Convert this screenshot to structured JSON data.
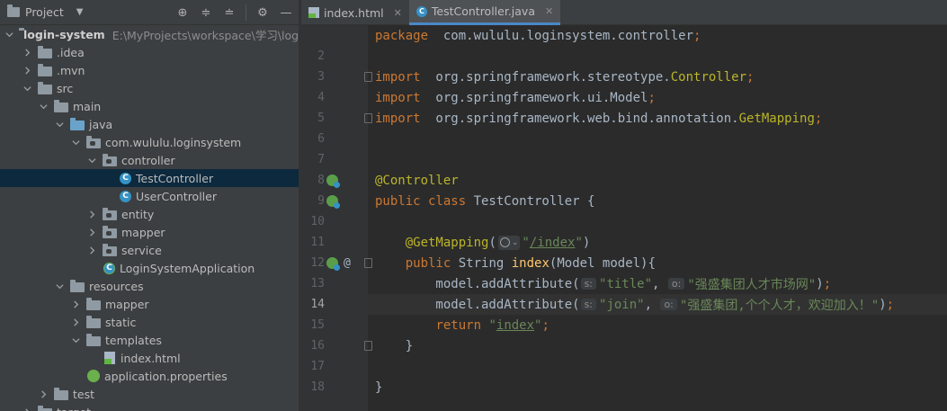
{
  "project_panel": {
    "title": "Project",
    "toolbar_icons": [
      "locate-icon",
      "expand-all-icon",
      "collapse-all-icon",
      "gear-icon",
      "minimize-icon"
    ],
    "tree": [
      {
        "label": "login-system",
        "path": "E:\\MyProjects\\workspace\\学习\\login-system",
        "depth": 0,
        "expanded": true,
        "icon": "folder-module-icon",
        "bold": true
      },
      {
        "label": ".idea",
        "depth": 1,
        "expanded": false,
        "icon": "folder-icon"
      },
      {
        "label": ".mvn",
        "depth": 1,
        "expanded": false,
        "icon": "folder-icon"
      },
      {
        "label": "src",
        "depth": 1,
        "expanded": true,
        "icon": "folder-icon"
      },
      {
        "label": "main",
        "depth": 2,
        "expanded": true,
        "icon": "folder-icon"
      },
      {
        "label": "java",
        "depth": 3,
        "expanded": true,
        "icon": "source-folder-icon"
      },
      {
        "label": "com.wululu.loginsystem",
        "depth": 4,
        "expanded": true,
        "icon": "package-icon"
      },
      {
        "label": "controller",
        "depth": 5,
        "expanded": true,
        "icon": "package-icon"
      },
      {
        "label": "TestController",
        "depth": 6,
        "icon": "java-class-icon",
        "selected": true
      },
      {
        "label": "UserController",
        "depth": 6,
        "icon": "java-class-icon"
      },
      {
        "label": "entity",
        "depth": 5,
        "expanded": false,
        "icon": "package-icon"
      },
      {
        "label": "mapper",
        "depth": 5,
        "expanded": false,
        "icon": "package-icon"
      },
      {
        "label": "service",
        "depth": 5,
        "expanded": false,
        "icon": "package-icon"
      },
      {
        "label": "LoginSystemApplication",
        "depth": 5,
        "icon": "spring-app-class-icon"
      },
      {
        "label": "resources",
        "depth": 3,
        "expanded": true,
        "icon": "resources-folder-icon"
      },
      {
        "label": "mapper",
        "depth": 4,
        "expanded": false,
        "icon": "folder-icon"
      },
      {
        "label": "static",
        "depth": 4,
        "expanded": false,
        "icon": "folder-icon"
      },
      {
        "label": "templates",
        "depth": 4,
        "expanded": true,
        "icon": "folder-icon"
      },
      {
        "label": "index.html",
        "depth": 5,
        "icon": "html-file-icon"
      },
      {
        "label": "application.properties",
        "depth": 4,
        "icon": "properties-file-icon"
      },
      {
        "label": "test",
        "depth": 2,
        "expanded": false,
        "icon": "folder-icon"
      },
      {
        "label": "target",
        "depth": 1,
        "expanded": false,
        "icon": "folder-icon"
      }
    ]
  },
  "editor": {
    "tabs": [
      {
        "label": "index.html",
        "icon": "html-file-icon",
        "active": false
      },
      {
        "label": "TestController.java",
        "icon": "java-class-icon",
        "active": true
      }
    ],
    "current_line": 14,
    "lines": [
      {
        "n": "",
        "tokens": [
          [
            "kw",
            "package"
          ],
          [
            "",
            "  com.wululu.loginsystem.controller"
          ],
          [
            "kw",
            ";"
          ]
        ]
      },
      {
        "n": "2",
        "tokens": []
      },
      {
        "n": "3",
        "tokens": [
          [
            "kw",
            "import"
          ],
          [
            "",
            "  org.springframework.stereotype."
          ],
          [
            "ann",
            "Controller"
          ],
          [
            "kw",
            ";"
          ]
        ],
        "fold": true
      },
      {
        "n": "4",
        "tokens": [
          [
            "kw",
            "import"
          ],
          [
            "",
            "  org.springframework.ui.Model"
          ],
          [
            "kw",
            ";"
          ]
        ]
      },
      {
        "n": "5",
        "tokens": [
          [
            "kw",
            "import"
          ],
          [
            "",
            "  org.springframework.web.bind.annotation."
          ],
          [
            "ann",
            "GetMapping"
          ],
          [
            "kw",
            ";"
          ]
        ],
        "fold": true
      },
      {
        "n": "6",
        "tokens": []
      },
      {
        "n": "7",
        "tokens": []
      },
      {
        "n": "8",
        "tokens": [
          [
            "ann",
            "@Controller"
          ]
        ],
        "bean": true
      },
      {
        "n": "9",
        "tokens": [
          [
            "kw",
            "public class "
          ],
          [
            "",
            "TestController {"
          ]
        ],
        "bean": true
      },
      {
        "n": "10",
        "tokens": []
      },
      {
        "n": "11",
        "tokens": [
          [
            "",
            "    "
          ],
          [
            "ann",
            "@GetMapping"
          ],
          [
            "",
            "("
          ],
          [
            "web",
            ""
          ],
          [
            "str",
            "\""
          ],
          [
            "strlink",
            "/index"
          ],
          [
            "str",
            "\""
          ],
          [
            "",
            ")"
          ]
        ]
      },
      {
        "n": "12",
        "tokens": [
          [
            "",
            "    "
          ],
          [
            "kw",
            "public "
          ],
          [
            "",
            "String "
          ],
          [
            "fn",
            "index"
          ],
          [
            "",
            "(Model model){"
          ]
        ],
        "bean": true,
        "at": true,
        "fold": true
      },
      {
        "n": "13",
        "tokens": [
          [
            "",
            "        model.addAttribute("
          ],
          [
            "hint",
            "s:"
          ],
          [
            "str",
            "\"title\""
          ],
          [
            "",
            ", "
          ],
          [
            "hint",
            "o:"
          ],
          [
            "str",
            "\"强盛集团人才市场网\""
          ],
          [
            "",
            ")"
          ],
          [
            "kw",
            ";"
          ]
        ]
      },
      {
        "n": "14",
        "tokens": [
          [
            "",
            "        model.addAttribute("
          ],
          [
            "hint",
            "s:"
          ],
          [
            "str",
            "\"join\""
          ],
          [
            "",
            ", "
          ],
          [
            "hint",
            "o:"
          ],
          [
            "str",
            "\"强盛集团,个个人才，欢迎加入！\""
          ],
          [
            "",
            ")"
          ],
          [
            "kw",
            ";"
          ]
        ]
      },
      {
        "n": "15",
        "tokens": [
          [
            "",
            "        "
          ],
          [
            "kw",
            "return "
          ],
          [
            "str",
            "\""
          ],
          [
            "strlink",
            "index"
          ],
          [
            "str",
            "\""
          ],
          [
            "kw",
            ";"
          ]
        ]
      },
      {
        "n": "16",
        "tokens": [
          [
            "",
            "    }"
          ]
        ],
        "fold": true
      },
      {
        "n": "17",
        "tokens": []
      },
      {
        "n": "18",
        "tokens": [
          [
            "",
            "}"
          ]
        ]
      }
    ]
  }
}
